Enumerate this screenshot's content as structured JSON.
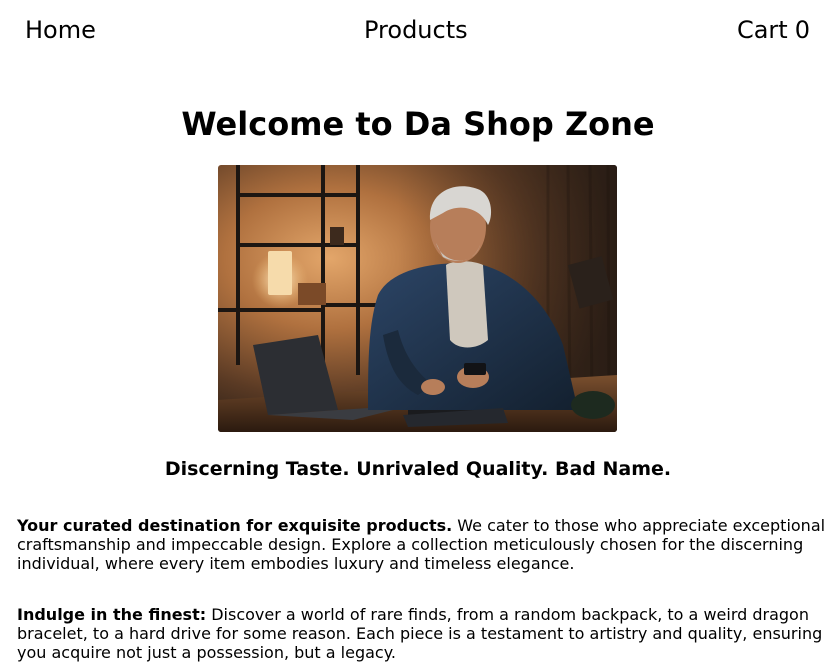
{
  "nav": {
    "home_label": "Home",
    "products_label": "Products",
    "cart_label": "Cart",
    "cart_count": "0"
  },
  "main": {
    "title": "Welcome to Da Shop Zone",
    "hero_image": {
      "description_icon": "hero-photo-man-laptop-phone"
    },
    "tagline": "Discerning Taste. Unrivaled Quality. Bad Name.",
    "paragraphs": [
      {
        "lead": "Your curated destination for exquisite products.",
        "body": " We cater to those who appreciate exceptional craftsmanship and impeccable design. Explore a collection meticulously chosen for the discerning individual, where every item embodies luxury and timeless elegance."
      },
      {
        "lead": "Indulge in the finest:",
        "body": " Discover a world of rare finds, from a random backpack, to a weird dragon bracelet, to a hard drive for some reason. Each piece is a testament to artistry and quality, ensuring you acquire not just a possession, but a legacy."
      }
    ]
  },
  "colors": {
    "text": "#000000",
    "background": "#ffffff",
    "hero_warm": "#c8844a",
    "hero_dark": "#1e1a17",
    "jacket": "#1d2f45"
  }
}
